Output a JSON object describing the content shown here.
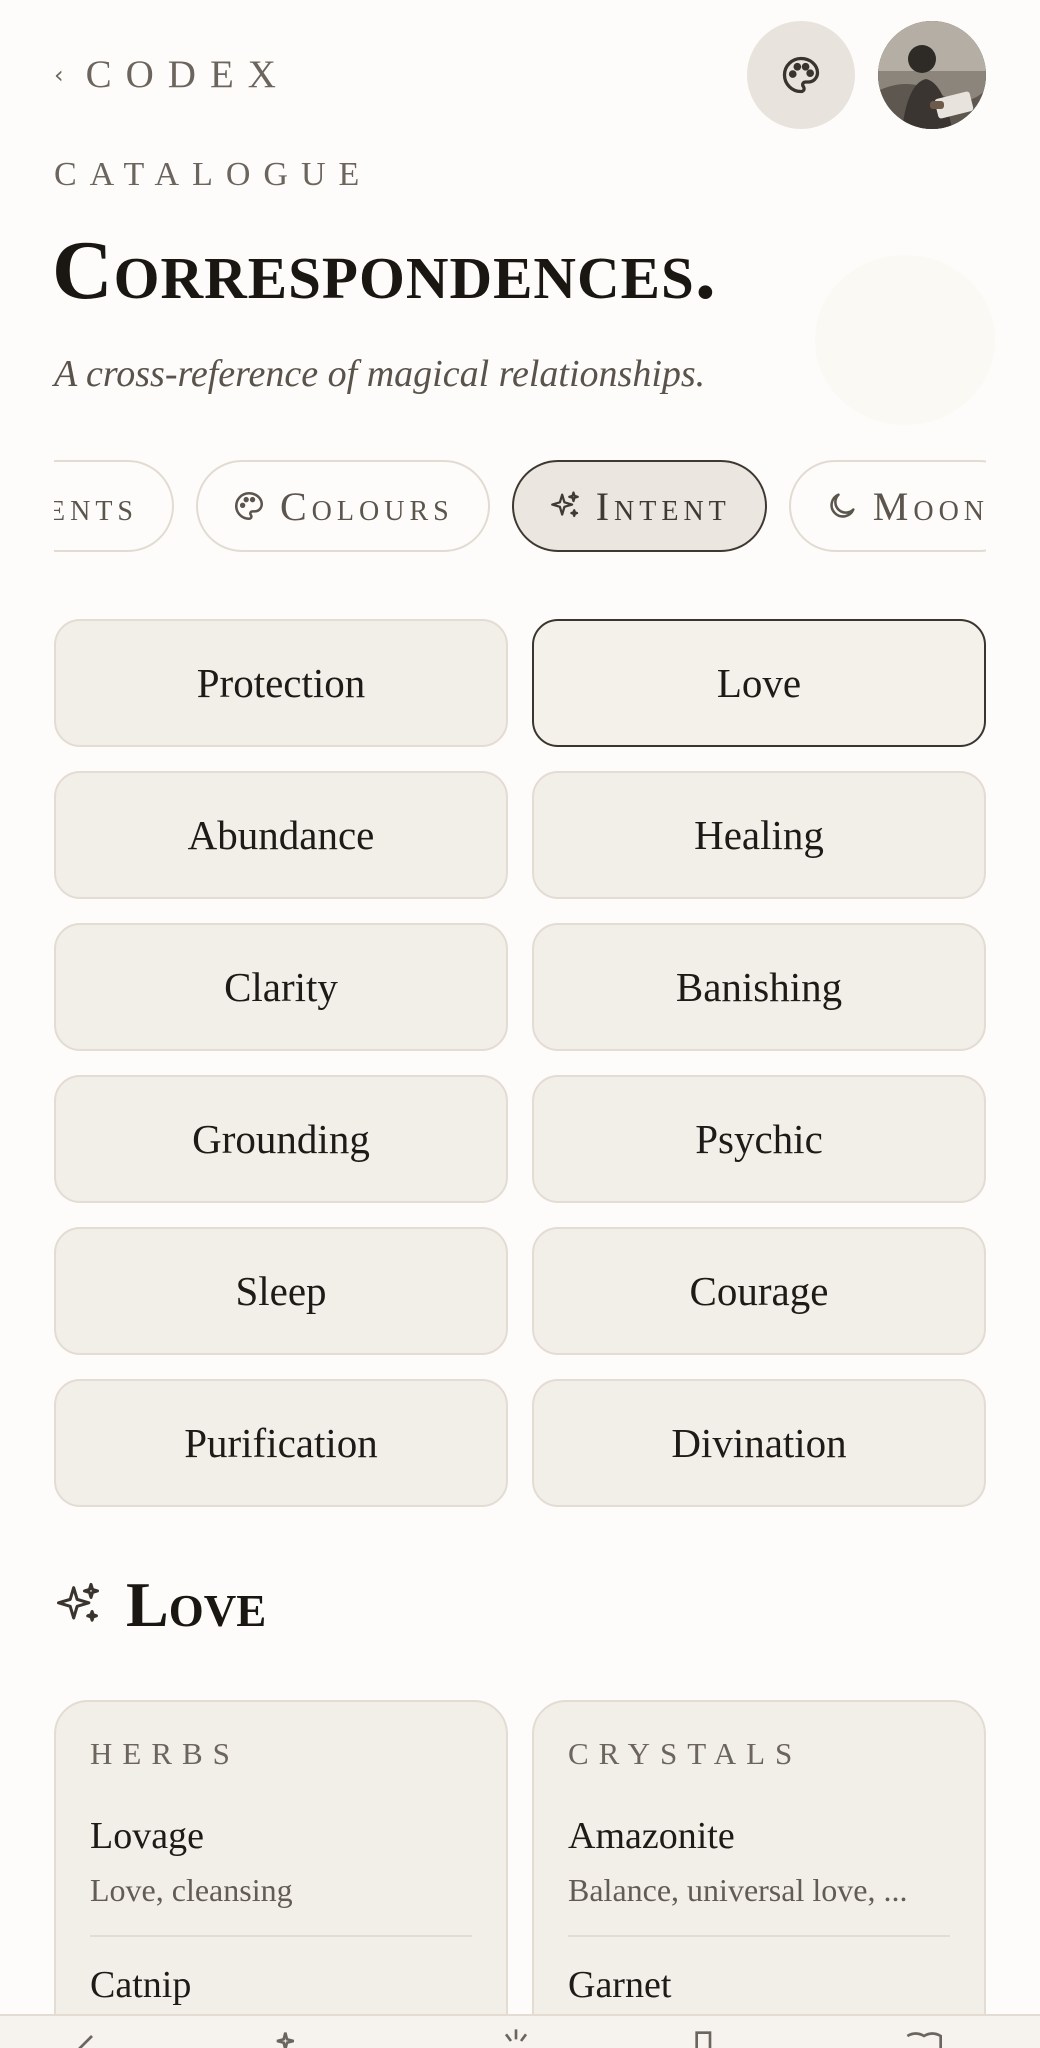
{
  "header": {
    "back_chevron": "‹",
    "back_label": "CODEX",
    "palette_icon": "palette-icon",
    "avatar": "user-avatar"
  },
  "page": {
    "eyebrow": "CATALOGUE",
    "title": "Correspondences.",
    "subtitle": "A cross-reference of magical relationships."
  },
  "tabs": [
    {
      "label": "ents",
      "icon": null,
      "active": false
    },
    {
      "label": "Colours",
      "icon": "palette-icon",
      "active": false
    },
    {
      "label": "Intent",
      "icon": "sparkles-icon",
      "active": true
    },
    {
      "label": "Moon",
      "icon": "moon-icon",
      "active": false
    }
  ],
  "intents": [
    {
      "label": "Protection",
      "selected": false
    },
    {
      "label": "Love",
      "selected": true
    },
    {
      "label": "Abundance",
      "selected": false
    },
    {
      "label": "Healing",
      "selected": false
    },
    {
      "label": "Clarity",
      "selected": false
    },
    {
      "label": "Banishing",
      "selected": false
    },
    {
      "label": "Grounding",
      "selected": false
    },
    {
      "label": "Psychic",
      "selected": false
    },
    {
      "label": "Sleep",
      "selected": false
    },
    {
      "label": "Courage",
      "selected": false
    },
    {
      "label": "Purification",
      "selected": false
    },
    {
      "label": "Divination",
      "selected": false
    }
  ],
  "section": {
    "icon": "sparkles-icon",
    "title": "Love"
  },
  "cards": [
    {
      "label": "HERBS",
      "entries": [
        {
          "name": "Lovage",
          "desc": "Love, cleansing"
        },
        {
          "name": "Catnip",
          "desc": ""
        }
      ]
    },
    {
      "label": "CRYSTALS",
      "entries": [
        {
          "name": "Amazonite",
          "desc": "Balance, universal love, ..."
        },
        {
          "name": "Garnet",
          "desc": ""
        }
      ]
    }
  ],
  "colors": {
    "background": "#fdfcfa",
    "chip_bg": "#f2eee8",
    "border": "#e3dcd3",
    "active_border": "#3b3530",
    "muted_text": "#6c655d"
  }
}
